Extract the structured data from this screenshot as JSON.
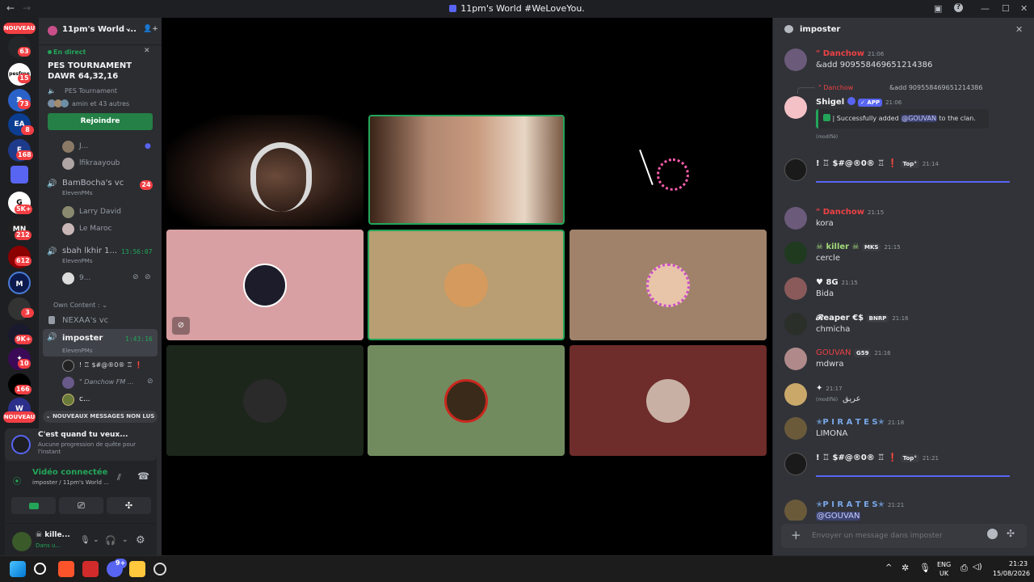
{
  "window": {
    "title": "11pm's World #WeLoveYou.",
    "back_glyph": "←",
    "forward_glyph": "→",
    "inbox_glyph": "▣",
    "help_glyph": "?",
    "min_glyph": "—",
    "max_glyph": "☐",
    "close_glyph": "✕"
  },
  "guilds": {
    "nouveau_top": "NOUVEAU",
    "nouveau_bottom": "NOUVEAU",
    "badges": [
      "63",
      "15",
      "73",
      "8",
      "168",
      "5K+",
      "212",
      "612",
      "3",
      "9K+",
      "10",
      "166"
    ]
  },
  "server": {
    "name": "11pm's World ...",
    "chevron": "⌄",
    "invite_icon": "👤+"
  },
  "event": {
    "live_label": "En direct",
    "title": "PES TOURNAMENT DAWR 64,32,16",
    "channel": "PES Tournament",
    "attendees": "amin et 43 autres",
    "join_label": "Rejoindre",
    "close_glyph": "✕"
  },
  "channels": {
    "u1": "J...",
    "u2": "lfikraayoub",
    "bam_name": "BamBocha's vc",
    "bam_sub": "ElevenPMs",
    "bam_badge": "24",
    "larry": "Larry David",
    "maroc": "Le Maroc",
    "sbah_name": "sbah lkhir 1...",
    "sbah_sub": "ElevenPMs",
    "sbah_time": "13:56:07",
    "u9": "9...",
    "category": "Own Content :",
    "nexaa": "NEXAA's vc",
    "imposter_name": "imposter",
    "imposter_sub": "ElevenPMs",
    "imposter_time": "1:43:16",
    "m1": "! ♖ $#@®0® ♖ ❗",
    "m2": "\" Danchow FM ...",
    "m3": "c...",
    "new_messages": "NOUVEAUX MESSAGES NON LUS"
  },
  "quest": {
    "title": "C'est quand tu veux...",
    "subtitle": "Aucune progression de quête pour l'instant"
  },
  "voice": {
    "status": "Vidéo connectée",
    "location": "imposter / 11pm's World ..."
  },
  "user": {
    "name": "☠ kille...",
    "status": "Dans u..."
  },
  "thread": {
    "title": "imposter",
    "close_glyph": "✕",
    "placeholder": "Envoyer un message dans imposter",
    "messages": [
      {
        "name": "\" Danchow",
        "time": "21:06",
        "text": "&add 909558469651214386"
      },
      {
        "name": "\" Danchow",
        "reply": "&add 909558469651214386"
      },
      {
        "name": "Shigel",
        "app": "✓ APP",
        "time": "21:06",
        "embed_pre": "| Successfully added ",
        "mention": "@GOUVAN",
        "embed_post": " to the clan.",
        "edited": "(modifié)"
      },
      {
        "name": "! ♖ $#@®0® ♖ ❗",
        "tag": "Top°",
        "time": "21:14"
      },
      {
        "name": "\" Danchow",
        "time": "21:15",
        "text": "kora"
      },
      {
        "name": "☠ killer ☠",
        "tag": "MKS",
        "time": "21:15",
        "text": "cercle"
      },
      {
        "name": "♥ 8G",
        "time": "21:15",
        "text": "Bida"
      },
      {
        "name": "𝓡eaper €$",
        "tag": "BNRP",
        "time": "21:16",
        "text": "chmicha"
      },
      {
        "name": "GOUVAN",
        "tag": "G59",
        "time": "21:16",
        "text": "mdwra"
      },
      {
        "name": "✦",
        "time": "21:17",
        "edited": "(modifié)",
        "text": "عريق"
      },
      {
        "name": "✭P I R A T E S✭",
        "time": "21:18",
        "text": "LIMONA"
      },
      {
        "name": "! ♖ $#@®0® ♖ ❗",
        "tag": "Top°",
        "time": "21:21"
      },
      {
        "name": "✭P I R A T E S✭",
        "time": "21:21",
        "text": "@GOUVAN"
      }
    ]
  },
  "taskbar": {
    "lang": "ENG",
    "region": "UK",
    "time": "21:23",
    "date": "15/08/2026",
    "discord_badge": "9+"
  }
}
